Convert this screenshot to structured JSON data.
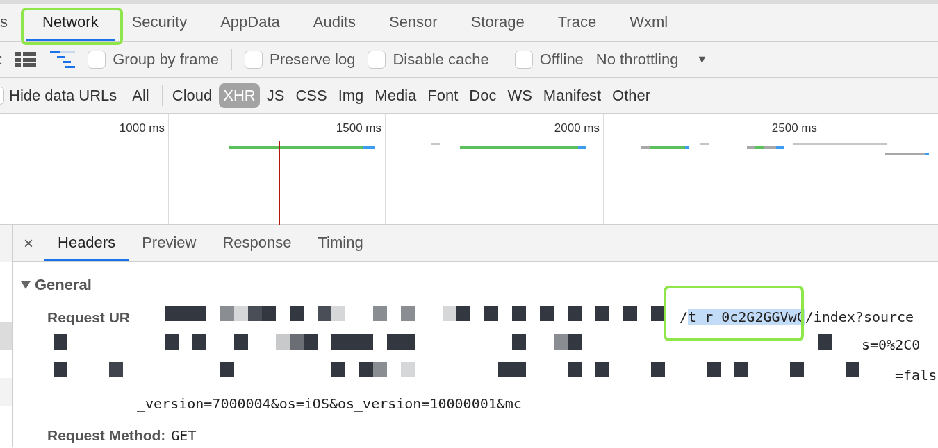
{
  "top_tabs": [
    {
      "label": "s",
      "selected": false
    },
    {
      "label": "Network",
      "selected": true
    },
    {
      "label": "Security",
      "selected": false
    },
    {
      "label": "AppData",
      "selected": false
    },
    {
      "label": "Audits",
      "selected": false
    },
    {
      "label": "Sensor",
      "selected": false
    },
    {
      "label": "Storage",
      "selected": false
    },
    {
      "label": "Trace",
      "selected": false
    },
    {
      "label": "Wxml",
      "selected": false
    }
  ],
  "toolbar": {
    "prefix": ":",
    "views": [
      {
        "kind": "list",
        "selected": false
      },
      {
        "kind": "waterfall",
        "selected": true
      }
    ],
    "checkboxes": [
      {
        "label": "Group by frame",
        "checked": false
      },
      {
        "label": "Preserve log",
        "checked": false
      },
      {
        "label": "Disable cache",
        "checked": false
      },
      {
        "label": "Offline",
        "checked": false
      }
    ],
    "throttling": "No throttling",
    "dropdown_arrow": "▼"
  },
  "filter": {
    "hide_data_urls": {
      "label": "Hide data URLs",
      "checked": false
    },
    "types": [
      {
        "label": "All",
        "selected": false
      },
      {
        "label": "Cloud",
        "selected": false
      },
      {
        "label": "XHR",
        "selected": true
      },
      {
        "label": "JS",
        "selected": false
      },
      {
        "label": "CSS",
        "selected": false
      },
      {
        "label": "Img",
        "selected": false
      },
      {
        "label": "Media",
        "selected": false
      },
      {
        "label": "Font",
        "selected": false
      },
      {
        "label": "Doc",
        "selected": false
      },
      {
        "label": "WS",
        "selected": false
      },
      {
        "label": "Manifest",
        "selected": false
      },
      {
        "label": "Other",
        "selected": false
      }
    ]
  },
  "timeline": {
    "ticks": [
      "1000 ms",
      "1500 ms",
      "2000 ms",
      "2500 ms"
    ]
  },
  "details": {
    "close": "×",
    "tabs": [
      {
        "label": "Headers",
        "selected": true
      },
      {
        "label": "Preview",
        "selected": false
      },
      {
        "label": "Response",
        "selected": false
      },
      {
        "label": "Timing",
        "selected": false
      }
    ],
    "section": {
      "title": "General",
      "expanded": true
    },
    "request_url_label": "Request UR",
    "url_main": {
      "before": "/",
      "selected_text": "t_r_0c2G2GGVwC",
      "after": "/index?source"
    },
    "url_fragments": [
      "s=0%2C0",
      "=fals",
      "_version=7000004&os=iOS&os_version=10000001&mc"
    ],
    "request_method_label": "Request Method:",
    "request_method": "GET"
  }
}
